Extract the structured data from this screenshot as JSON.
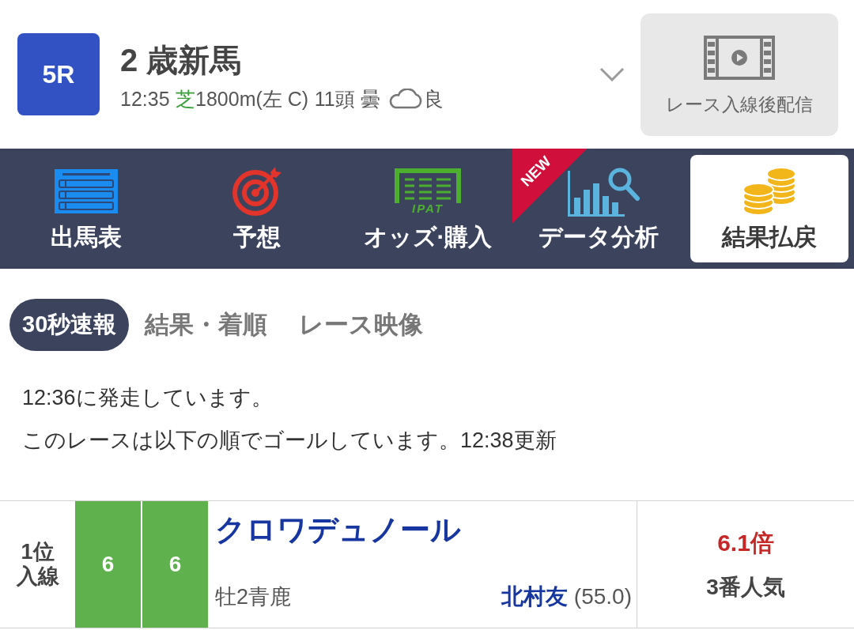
{
  "race_header": {
    "race_number": "5R",
    "title": "2 歳新馬",
    "info": {
      "time": "12:35",
      "surface": "芝",
      "distance": "1800m(左 C)",
      "runners": "11頭",
      "weather": "曇",
      "going": "良"
    },
    "video_button": {
      "label": "レース入線後配信",
      "disabled": true
    }
  },
  "menu_tabs": [
    {
      "kind": "entries",
      "label": "出馬表",
      "selected": false
    },
    {
      "kind": "prediction",
      "label": "予想",
      "selected": false
    },
    {
      "kind": "odds",
      "label": "オッズ·購入",
      "logo_text": "IPAT",
      "selected": false
    },
    {
      "kind": "analysis",
      "label": "データ分析",
      "badge": "NEW",
      "selected": false
    },
    {
      "kind": "payout",
      "label": "結果払戻",
      "selected": true
    }
  ],
  "sub_tabs": [
    {
      "label": "30秒速報",
      "selected": true
    },
    {
      "label": "結果・着順",
      "selected": false
    },
    {
      "label": "レース映像",
      "selected": false
    }
  ],
  "messages": [
    "12:36に発走しています。",
    "このレースは以下の順でゴールしています。12:38更新"
  ],
  "results": [
    {
      "rank": "1位",
      "status": "入線",
      "color": "#5eb14c",
      "frame": "6",
      "number": "6",
      "horse": "クロワデュノール",
      "details": "牡2青鹿",
      "jockey": "北村友",
      "weight": "(55.0)",
      "odds": "6.1倍",
      "popularity": "3番人気"
    }
  ]
}
